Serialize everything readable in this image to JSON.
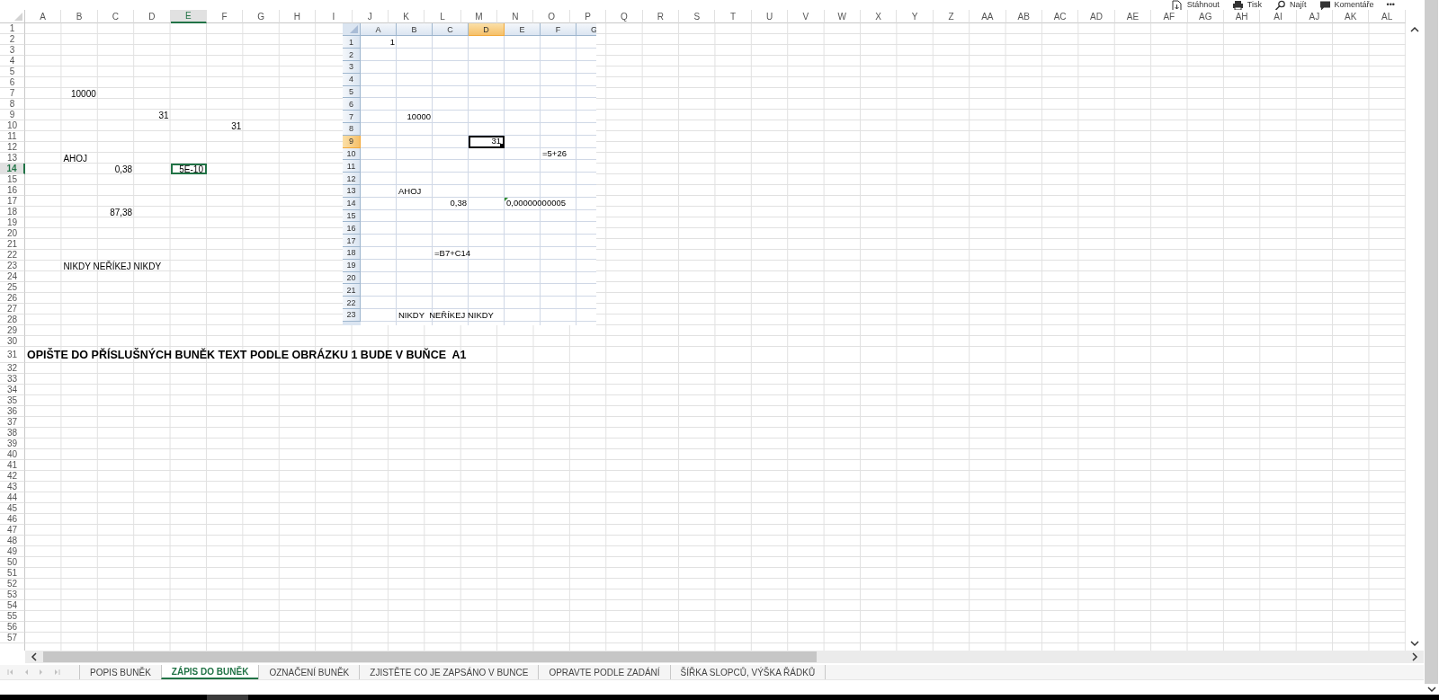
{
  "toolbar": [
    {
      "kind": "download",
      "label": "Stáhnout"
    },
    {
      "kind": "print",
      "label": "Tisk"
    },
    {
      "kind": "find",
      "label": "Najít"
    },
    {
      "kind": "comment",
      "label": "Komentáře"
    },
    {
      "kind": "more",
      "label": "•••"
    }
  ],
  "sheet": {
    "column_headers": [
      {
        "label": "A",
        "selected": false
      },
      {
        "label": "B",
        "selected": false
      },
      {
        "label": "C",
        "selected": false
      },
      {
        "label": "D",
        "selected": false
      },
      {
        "label": "E",
        "selected": true
      },
      {
        "label": "F",
        "selected": false
      },
      {
        "label": "G",
        "selected": false
      },
      {
        "label": "H",
        "selected": false
      },
      {
        "label": "I",
        "selected": false
      },
      {
        "label": "J",
        "selected": false
      },
      {
        "label": "K",
        "selected": false
      },
      {
        "label": "L",
        "selected": false
      },
      {
        "label": "M",
        "selected": false
      },
      {
        "label": "N",
        "selected": false
      },
      {
        "label": "O",
        "selected": false
      },
      {
        "label": "P",
        "selected": false
      },
      {
        "label": "Q",
        "selected": false
      },
      {
        "label": "R",
        "selected": false
      },
      {
        "label": "S",
        "selected": false
      },
      {
        "label": "T",
        "selected": false
      },
      {
        "label": "U",
        "selected": false
      },
      {
        "label": "V",
        "selected": false
      },
      {
        "label": "W",
        "selected": false
      },
      {
        "label": "X",
        "selected": false
      },
      {
        "label": "Y",
        "selected": false
      },
      {
        "label": "Z",
        "selected": false
      },
      {
        "label": "AA",
        "selected": false
      },
      {
        "label": "AB",
        "selected": false
      },
      {
        "label": "AC",
        "selected": false
      },
      {
        "label": "AD",
        "selected": false
      },
      {
        "label": "AE",
        "selected": false
      },
      {
        "label": "AF",
        "selected": false
      },
      {
        "label": "AG",
        "selected": false
      },
      {
        "label": "AH",
        "selected": false
      },
      {
        "label": "AI",
        "selected": false
      },
      {
        "label": "AJ",
        "selected": false
      },
      {
        "label": "AK",
        "selected": false
      },
      {
        "label": "AL",
        "selected": false
      }
    ],
    "rows": [
      {
        "header": "1",
        "selected": false
      },
      {
        "header": "2",
        "selected": false
      },
      {
        "header": "3",
        "selected": false
      },
      {
        "header": "4",
        "selected": false
      },
      {
        "header": "5",
        "selected": false
      },
      {
        "header": "6",
        "selected": false
      },
      {
        "header": "7",
        "selected": false,
        "cells": {
          "B": {
            "text": "10000",
            "kind": "number",
            "selected": false
          }
        }
      },
      {
        "header": "8",
        "selected": false
      },
      {
        "header": "9",
        "selected": false,
        "cells": {
          "D": {
            "text": "31",
            "kind": "number",
            "selected": false
          }
        }
      },
      {
        "header": "10",
        "selected": false,
        "cells": {
          "F": {
            "text": "31",
            "kind": "number",
            "selected": false
          }
        }
      },
      {
        "header": "11",
        "selected": false
      },
      {
        "header": "12",
        "selected": false
      },
      {
        "header": "13",
        "selected": false,
        "cells": {
          "B": {
            "text": "AHOJ",
            "kind": "text",
            "selected": false
          }
        }
      },
      {
        "header": "14",
        "selected": true,
        "cells": {
          "C": {
            "text": "0,38",
            "kind": "number",
            "selected": false
          },
          "E": {
            "text": "5E-10",
            "kind": "number",
            "selected": true
          }
        }
      },
      {
        "header": "15",
        "selected": false
      },
      {
        "header": "16",
        "selected": false
      },
      {
        "header": "17",
        "selected": false
      },
      {
        "header": "18",
        "selected": false,
        "cells": {
          "C": {
            "text": "87,38",
            "kind": "number",
            "selected": false
          }
        }
      },
      {
        "header": "19",
        "selected": false
      },
      {
        "header": "20",
        "selected": false
      },
      {
        "header": "21",
        "selected": false
      },
      {
        "header": "22",
        "selected": false
      },
      {
        "header": "23",
        "selected": false,
        "cells": {
          "B": {
            "text": "NIKDY NEŘÍKEJ NIKDY",
            "kind": "text",
            "selected": false
          }
        }
      },
      {
        "header": "24",
        "selected": false
      },
      {
        "header": "25",
        "selected": false
      },
      {
        "header": "26",
        "selected": false
      },
      {
        "header": "27",
        "selected": false
      },
      {
        "header": "28",
        "selected": false
      },
      {
        "header": "29",
        "selected": false
      },
      {
        "header": "30",
        "selected": false
      },
      {
        "header": "31",
        "selected": false,
        "cells": {
          "A": {
            "text": "OPIŠTE DO PŘÍSLUŠNÝCH BUNĚK TEXT PODLE OBRÁZKU 1 BUDE V BUŇCE  A1",
            "kind": "heading",
            "selected": false
          }
        }
      },
      {
        "header": "32",
        "selected": false
      },
      {
        "header": "33",
        "selected": false
      },
      {
        "header": "34",
        "selected": false
      },
      {
        "header": "35",
        "selected": false
      },
      {
        "header": "36",
        "selected": false
      },
      {
        "header": "37",
        "selected": false
      },
      {
        "header": "38",
        "selected": false
      },
      {
        "header": "39",
        "selected": false
      },
      {
        "header": "40",
        "selected": false
      },
      {
        "header": "41",
        "selected": false
      },
      {
        "header": "42",
        "selected": false
      },
      {
        "header": "43",
        "selected": false
      },
      {
        "header": "44",
        "selected": false
      },
      {
        "header": "45",
        "selected": false
      },
      {
        "header": "46",
        "selected": false
      },
      {
        "header": "47",
        "selected": false
      },
      {
        "header": "48",
        "selected": false
      },
      {
        "header": "49",
        "selected": false
      },
      {
        "header": "50",
        "selected": false
      },
      {
        "header": "51",
        "selected": false
      },
      {
        "header": "52",
        "selected": false
      },
      {
        "header": "53",
        "selected": false
      },
      {
        "header": "54",
        "selected": false
      },
      {
        "header": "55",
        "selected": false
      },
      {
        "header": "56",
        "selected": false
      },
      {
        "header": "57",
        "selected": false
      }
    ]
  },
  "embedded_sheet": {
    "column_headers": [
      {
        "label": "A",
        "selected": false
      },
      {
        "label": "B",
        "selected": false
      },
      {
        "label": "C",
        "selected": false
      },
      {
        "label": "D",
        "selected": true
      },
      {
        "label": "E",
        "selected": false
      },
      {
        "label": "F",
        "selected": false
      },
      {
        "label": "G",
        "selected": false
      }
    ],
    "rows": [
      {
        "header": "1",
        "selected": false,
        "cells": {
          "A": {
            "text": "1",
            "kind": "number",
            "selected": false,
            "error_mark": false
          }
        }
      },
      {
        "header": "2",
        "selected": false
      },
      {
        "header": "3",
        "selected": false
      },
      {
        "header": "4",
        "selected": false
      },
      {
        "header": "5",
        "selected": false
      },
      {
        "header": "6",
        "selected": false
      },
      {
        "header": "7",
        "selected": false,
        "cells": {
          "B": {
            "text": "10000",
            "kind": "number",
            "selected": false,
            "error_mark": false
          }
        }
      },
      {
        "header": "8",
        "selected": false
      },
      {
        "header": "9",
        "selected": true,
        "cells": {
          "D": {
            "text": "31",
            "kind": "number",
            "selected": true,
            "error_mark": false
          }
        }
      },
      {
        "header": "10",
        "selected": false,
        "cells": {
          "F": {
            "text": "=5+26",
            "kind": "text",
            "selected": false,
            "error_mark": false
          }
        }
      },
      {
        "header": "11",
        "selected": false
      },
      {
        "header": "12",
        "selected": false
      },
      {
        "header": "13",
        "selected": false,
        "cells": {
          "B": {
            "text": "AHOJ",
            "kind": "text",
            "selected": false,
            "error_mark": false
          }
        }
      },
      {
        "header": "14",
        "selected": false,
        "cells": {
          "C": {
            "text": "0,38",
            "kind": "number",
            "selected": false,
            "error_mark": false
          },
          "E": {
            "text": "0,00000000005",
            "kind": "text",
            "selected": false,
            "error_mark": true
          }
        }
      },
      {
        "header": "15",
        "selected": false
      },
      {
        "header": "16",
        "selected": false
      },
      {
        "header": "17",
        "selected": false
      },
      {
        "header": "18",
        "selected": false,
        "cells": {
          "C": {
            "text": "=B7+C14",
            "kind": "text",
            "selected": false,
            "error_mark": false
          }
        }
      },
      {
        "header": "19",
        "selected": false
      },
      {
        "header": "20",
        "selected": false
      },
      {
        "header": "21",
        "selected": false
      },
      {
        "header": "22",
        "selected": false
      },
      {
        "header": "23",
        "selected": false,
        "cells": {
          "B": {
            "text": "NIKDY  NEŘÍKEJ NIKDY",
            "kind": "text",
            "selected": false,
            "error_mark": false
          }
        }
      }
    ]
  },
  "sheet_tabs": [
    {
      "label": "POPIS BUNĚK",
      "selected": false
    },
    {
      "label": "ZÁPIS DO BUNĚK",
      "selected": true
    },
    {
      "label": "OZNAČENÍ BUNĚK",
      "selected": false
    },
    {
      "label": "ZJISTĚTE CO JE ZAPSÁNO V BUNCE",
      "selected": false
    },
    {
      "label": "OPRAVTE PODLE ZADÁNÍ",
      "selected": false
    },
    {
      "label": "ŠÍŘKA SLOPCŮ, VÝŠKA ŘÁDKŮ",
      "selected": false
    }
  ]
}
